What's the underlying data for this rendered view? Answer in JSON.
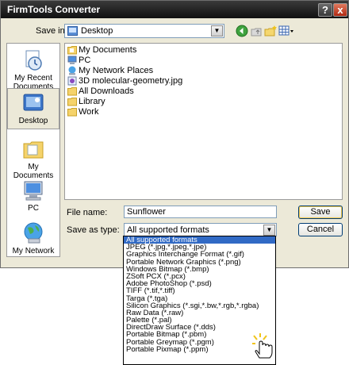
{
  "window": {
    "title": "FirmTools Converter",
    "help_label": "?",
    "close_label": "x"
  },
  "toolbar": {
    "save_in_label": "Save in:",
    "save_in_value": "Desktop"
  },
  "places": [
    {
      "label": "My Recent Documents"
    },
    {
      "label": "Desktop"
    },
    {
      "label": "My Documents"
    },
    {
      "label": "PC"
    },
    {
      "label": "My Network"
    }
  ],
  "files": [
    {
      "name": "My Documents",
      "icon": "documents-folder-icon"
    },
    {
      "name": "PC",
      "icon": "computer-icon"
    },
    {
      "name": "My Network Places",
      "icon": "network-icon"
    },
    {
      "name": "3D molecular-geometry.jpg",
      "icon": "image-file-icon"
    },
    {
      "name": "All Downloads",
      "icon": "folder-icon"
    },
    {
      "name": "Library",
      "icon": "folder-icon"
    },
    {
      "name": "Work",
      "icon": "folder-icon"
    }
  ],
  "form": {
    "file_name_label": "File name:",
    "file_name_value": "Sunflower",
    "save_as_type_label": "Save as type:",
    "save_as_type_value": "All supported formats",
    "save_button": "Save",
    "cancel_button": "Cancel"
  },
  "type_options": [
    "All supported formats",
    "JPEG (*.jpg,*.jpeg,*.jpe)",
    "Graphics Interchange Format (*.gif)",
    "Portable Network Graphics (*.png)",
    "Windows Bitmap (*.bmp)",
    "ZSoft PCX (*.pcx)",
    "Adobe PhotoShop (*.psd)",
    "TIFF (*.tif,*.tiff)",
    "Targa (*.tga)",
    "Silicon Graphics (*.sgi,*.bw,*.rgb,*.rgba)",
    "Raw Data (*.raw)",
    "Palette (*.pal)",
    "DirectDraw Surface (*.dds)",
    "Portable Bitmap (*.pbm)",
    "Portable Greymap (*.pgm)",
    "Portable Pixmap (*.ppm)"
  ],
  "colors": {
    "selection": "#316ac5",
    "titlebar": "#1a1a1a",
    "dialog_bg": "#ece9d8"
  }
}
